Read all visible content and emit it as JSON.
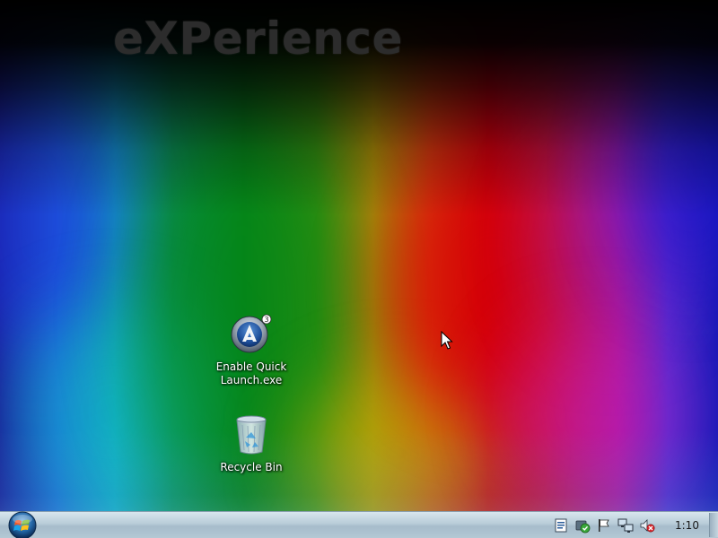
{
  "wallpaper": {
    "brand_text": "eXPerience"
  },
  "desktop_icons": [
    {
      "label": "Enable Quick Launch.exe",
      "icon": "autoit-app-icon"
    },
    {
      "label": "Recycle Bin",
      "icon": "recycle-bin-icon"
    }
  ],
  "taskbar": {
    "start_icon": "windows-logo-icon",
    "tray_icons": [
      "notes-icon",
      "security-shield-icon",
      "action-center-flag-icon",
      "network-icon",
      "volume-muted-icon"
    ],
    "clock": "1:10"
  },
  "colors": {
    "taskbar": "#b8ccd8",
    "label_text": "#ffffff"
  }
}
